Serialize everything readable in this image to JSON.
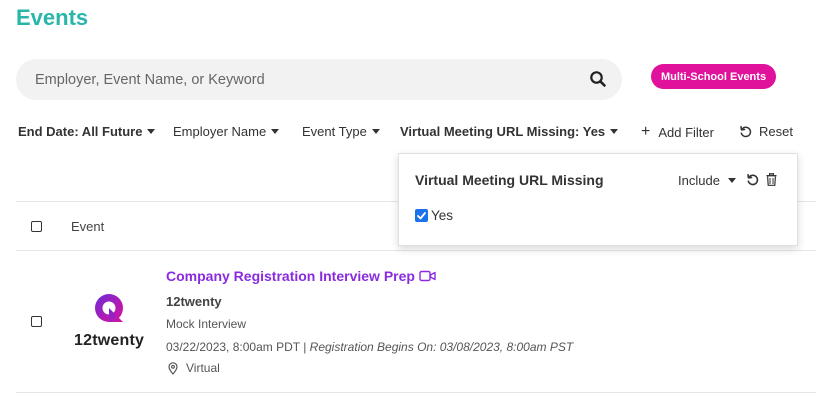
{
  "header": {
    "title": "Events"
  },
  "search": {
    "placeholder": "Employer, Event Name, or Keyword",
    "value": ""
  },
  "multi_school_button": {
    "label": "Multi-School Events",
    "color": "#e0119b"
  },
  "filters": [
    {
      "label": "End Date: All Future",
      "bold": true
    },
    {
      "label": "Employer Name",
      "bold": false
    },
    {
      "label": "Event Type",
      "bold": false
    },
    {
      "label": "Virtual Meeting URL Missing: Yes",
      "bold": true
    }
  ],
  "add_filter": {
    "label": "Add Filter"
  },
  "reset": {
    "label": "Reset"
  },
  "table": {
    "column_event": "Event"
  },
  "filter_popover": {
    "title": "Virtual Meeting URL Missing",
    "mode": "Include",
    "option_label": "Yes",
    "option_checked": true
  },
  "events": [
    {
      "title": "Company Registration Interview Prep",
      "employer": "12twenty",
      "logo_text": "12twenty",
      "type": "Mock Interview",
      "date": "03/22/2023, 8:00am PDT",
      "registration": "Registration Begins On: 03/08/2023, 8:00am PST",
      "location": "Virtual",
      "icon": "video-camera-icon"
    }
  ],
  "colors": {
    "title_teal": "#29b5a8",
    "event_purple": "#8a2be2",
    "checkbox_blue": "#1a73e8"
  }
}
